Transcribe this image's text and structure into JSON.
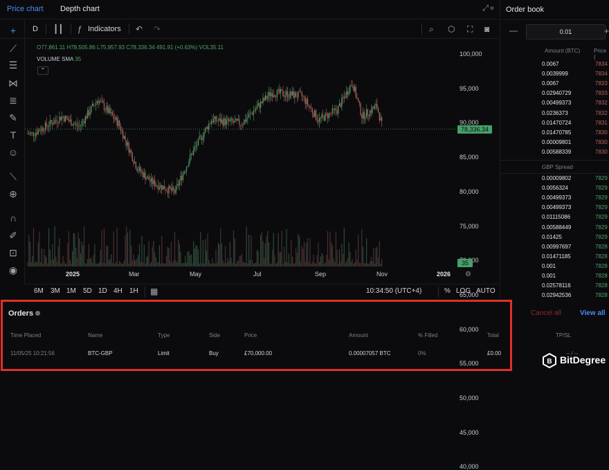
{
  "tabs": {
    "price_chart": "Price chart",
    "depth_chart": "Depth chart"
  },
  "toolbar": {
    "interval": "D",
    "indicators": "Indicators"
  },
  "legend": {
    "ohlc": "O77,861.11 H78,505.86 L75,957.93 C78,336.34 491.91 (+0.63%) VOL35.11",
    "volume_sma_label": "VOLUME SMA",
    "volume_sma_value": "35"
  },
  "price_axis": {
    "labels": [
      "100,000",
      "95,000",
      "90,000",
      "85,000",
      "80,000",
      "75,000",
      "70,000",
      "65,000",
      "60,000",
      "55,000",
      "50,000",
      "45,000",
      "40,000"
    ],
    "current_price": "78,336.34",
    "volume_tag": "35"
  },
  "time_axis": {
    "labels": [
      {
        "text": "2025",
        "bold": true
      },
      {
        "text": "Mar",
        "bold": false
      },
      {
        "text": "May",
        "bold": false
      },
      {
        "text": "Jul",
        "bold": false
      },
      {
        "text": "Sep",
        "bold": false
      },
      {
        "text": "Nov",
        "bold": false
      },
      {
        "text": "2026",
        "bold": true
      }
    ]
  },
  "ranges": [
    "6M",
    "3M",
    "1M",
    "5D",
    "1D",
    "4H",
    "1H"
  ],
  "bottom_bar": {
    "clock": "10:34:50 (UTC+4)",
    "percent": "%",
    "log": "LOG",
    "auto": "AUTO"
  },
  "orders": {
    "title": "Orders",
    "cancel_all": "Cancel all",
    "view_all": "View all",
    "headers": [
      "Time Placed",
      "Name",
      "Type",
      "Side",
      "Price",
      "Amount",
      "% Filled",
      "Total",
      "TP/SL"
    ],
    "row": {
      "time": "11/05/25 10:21:56",
      "name": "BTC-GBP",
      "type": "Limit",
      "side": "Buy",
      "price": "£70,000.00",
      "amount": "0.00007057 BTC",
      "filled": "0%",
      "total": "£0.00",
      "tpsl": "-- / --"
    }
  },
  "order_book": {
    "title": "Order book",
    "tick_size": "0.01",
    "headers": {
      "amount": "Amount (BTC)",
      "price": "Price ("
    },
    "spread_label": "GBP Spread",
    "asks": [
      {
        "amount": "0.0067",
        "price": "7834"
      },
      {
        "amount": "0.0039999",
        "price": "7834"
      },
      {
        "amount": "0.0067",
        "price": "7833"
      },
      {
        "amount": "0.02940729",
        "price": "7833"
      },
      {
        "amount": "0.00499373",
        "price": "7832"
      },
      {
        "amount": "0.0236373",
        "price": "7832"
      },
      {
        "amount": "0.01470724",
        "price": "7831"
      },
      {
        "amount": "0.01470785",
        "price": "7830"
      },
      {
        "amount": "0.00009801",
        "price": "7830"
      },
      {
        "amount": "0.00588339",
        "price": "7830"
      }
    ],
    "bids": [
      {
        "amount": "0.00009802",
        "price": "7829"
      },
      {
        "amount": "0.0056324",
        "price": "7829"
      },
      {
        "amount": "0.00499373",
        "price": "7829"
      },
      {
        "amount": "0.00499373",
        "price": "7829"
      },
      {
        "amount": "0.01115086",
        "price": "7829"
      },
      {
        "amount": "0.00588449",
        "price": "7829"
      },
      {
        "amount": "0.01425",
        "price": "7829"
      },
      {
        "amount": "0.00997697",
        "price": "7828"
      },
      {
        "amount": "0.01471185",
        "price": "7828"
      },
      {
        "amount": "0.001",
        "price": "7828"
      },
      {
        "amount": "0.001",
        "price": "7828"
      },
      {
        "amount": "0.02578116",
        "price": "7828"
      },
      {
        "amount": "0.02942536",
        "price": "7828"
      }
    ]
  },
  "branding": {
    "logo_text": "BitDegree"
  },
  "colors": {
    "up": "#4fa36a",
    "down": "#c0605f",
    "accent": "#4a8df8",
    "highlight_border": "#e0302a"
  },
  "chart_data": {
    "type": "candlestick",
    "symbol_interval": "D",
    "ylim": [
      40000,
      100000
    ],
    "current_price": 78336.34,
    "close_series_approx": [
      {
        "date": "2024-11-15",
        "close": 77000
      },
      {
        "date": "2024-12-15",
        "close": 82000
      },
      {
        "date": "2025-01-01",
        "close": 79000
      },
      {
        "date": "2025-01-20",
        "close": 87000
      },
      {
        "date": "2025-02-10",
        "close": 80000
      },
      {
        "date": "2025-03-01",
        "close": 67000
      },
      {
        "date": "2025-03-15",
        "close": 63000
      },
      {
        "date": "2025-04-08",
        "close": 60000
      },
      {
        "date": "2025-04-25",
        "close": 71000
      },
      {
        "date": "2025-05-15",
        "close": 81000
      },
      {
        "date": "2025-06-15",
        "close": 80000
      },
      {
        "date": "2025-07-15",
        "close": 89000
      },
      {
        "date": "2025-08-15",
        "close": 88000
      },
      {
        "date": "2025-09-01",
        "close": 81000
      },
      {
        "date": "2025-09-20",
        "close": 84000
      },
      {
        "date": "2025-10-05",
        "close": 92000
      },
      {
        "date": "2025-10-15",
        "close": 82000
      },
      {
        "date": "2025-10-30",
        "close": 85000
      },
      {
        "date": "2025-11-05",
        "close": 78336
      }
    ]
  }
}
